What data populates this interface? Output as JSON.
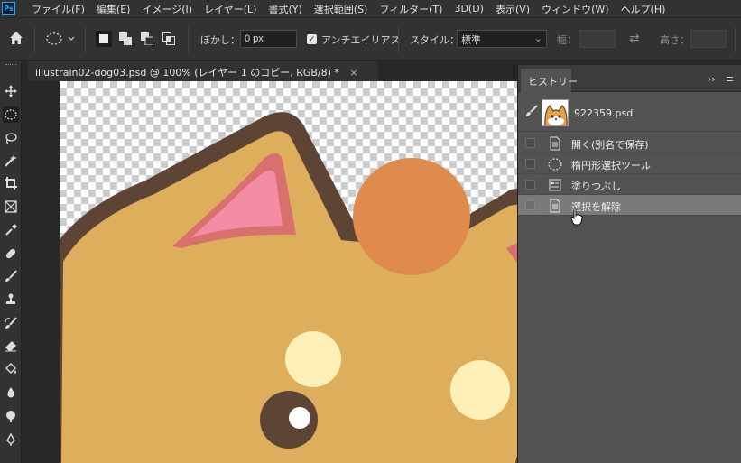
{
  "app": {
    "logo": "Ps"
  },
  "menu": [
    "ファイル(F)",
    "編集(E)",
    "イメージ(I)",
    "レイヤー(L)",
    "書式(Y)",
    "選択範囲(S)",
    "フィルター(T)",
    "3D(D)",
    "表示(V)",
    "ウィンドウ(W)",
    "ヘルプ(H)"
  ],
  "options": {
    "feather_label": "ぼかし：",
    "feather_value": "0 px",
    "antialias_label": "アンチエイリアス",
    "antialias_checked": true,
    "style_label": "スタイル：",
    "style_value": "標準",
    "width_label": "幅：",
    "height_label": "高さ："
  },
  "document": {
    "tab_title": "illustrain02-dog03.psd @ 100% (レイヤー 1 のコピー, RGB/8) *",
    "close": "×"
  },
  "tools": [
    "move-icon",
    "elliptical-marquee-icon",
    "lasso-icon",
    "magic-wand-icon",
    "crop-icon",
    "frame-icon",
    "eyedropper-icon",
    "healing-brush-icon",
    "brush-icon",
    "clone-stamp-icon",
    "history-brush-icon",
    "eraser-icon",
    "paint-bucket-icon",
    "blur-icon",
    "dodge-icon",
    "pen-icon"
  ],
  "history": {
    "tab": "ヒストリー",
    "snapshot_name": "922359.psd",
    "items": [
      {
        "label": "開く(別名で保存)",
        "icon": "document-icon"
      },
      {
        "label": "楕円形選択ツール",
        "icon": "ellipse-select-icon"
      },
      {
        "label": "塗りつぶし",
        "icon": "fill-icon"
      },
      {
        "label": "選択を解除",
        "icon": "document-icon",
        "selected": true
      }
    ]
  },
  "colors": {
    "dog_body": "#ddaf5c",
    "dog_outline": "#5e4434",
    "ear_inner": "#f58ca6",
    "ear_rim": "#d8706e",
    "filled_circle": "#df8b4e",
    "cheek_spot": "#fdf0b9"
  }
}
